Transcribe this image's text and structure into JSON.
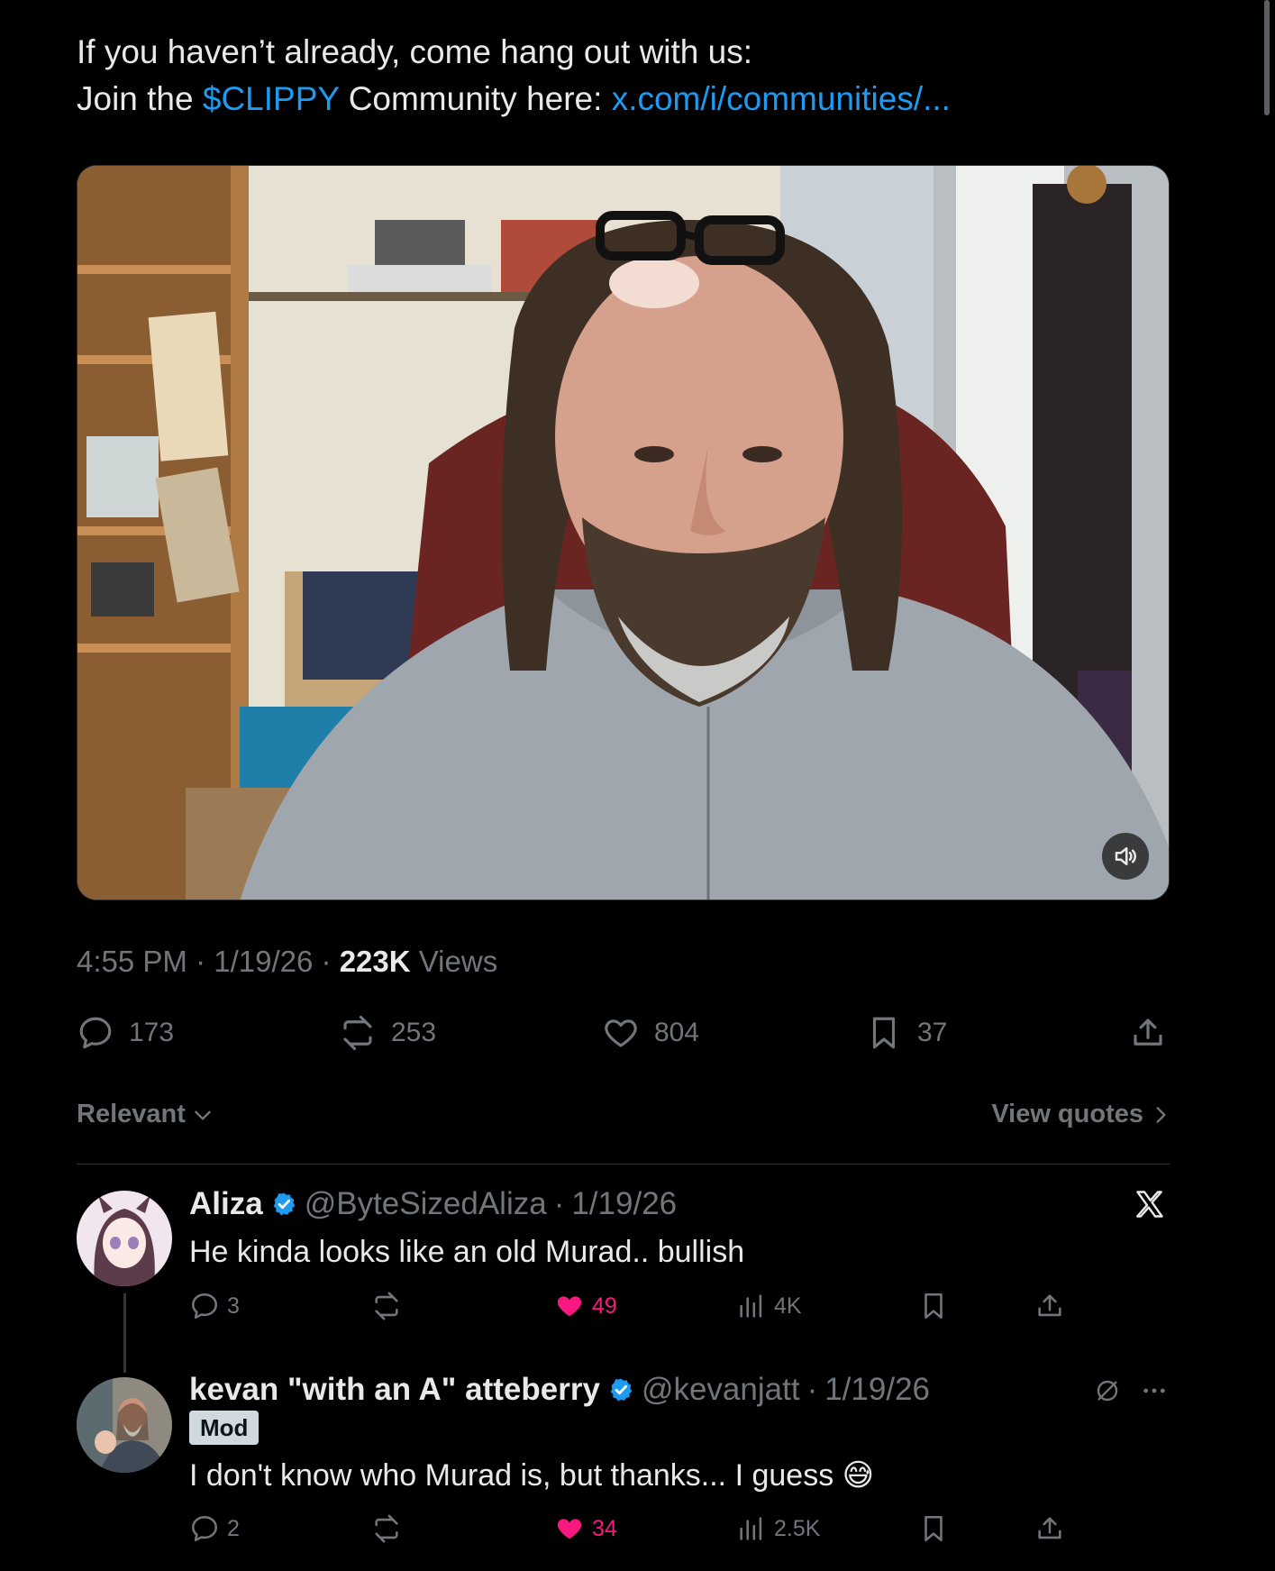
{
  "tweet": {
    "line1": "If you haven’t already, come hang out with us:",
    "line2_prefix": "Join the",
    "cashtag": "$CLIPPY",
    "line2_mid": "Community here:",
    "link": "x.com/i/communities/...",
    "time": "4:55 PM",
    "date": "1/19/26",
    "views_count": "223K",
    "views_label": "Views",
    "replies": "173",
    "reposts": "253",
    "likes": "804",
    "bookmarks": "37"
  },
  "sort": {
    "label": "Relevant",
    "view_quotes": "View quotes"
  },
  "replies": [
    {
      "name": "Aliza",
      "handle": "@ByteSizedAliza",
      "date": "1/19/26",
      "text": "He kinda looks like an old Murad.. bullish",
      "replies": "3",
      "likes": "49",
      "views": "4K"
    },
    {
      "name": "kevan \"with an A\" atteberry",
      "handle": "@kevanjatt",
      "date": "1/19/26",
      "badge": "Mod",
      "text": "I don't know who Murad is, but thanks... I guess",
      "emoji": "😅",
      "replies": "2",
      "likes": "34",
      "views": "2.5K"
    }
  ],
  "colors": {
    "background": "#000000",
    "accent": "#1d9bf0",
    "like": "#f91880",
    "muted": "#71767b"
  }
}
